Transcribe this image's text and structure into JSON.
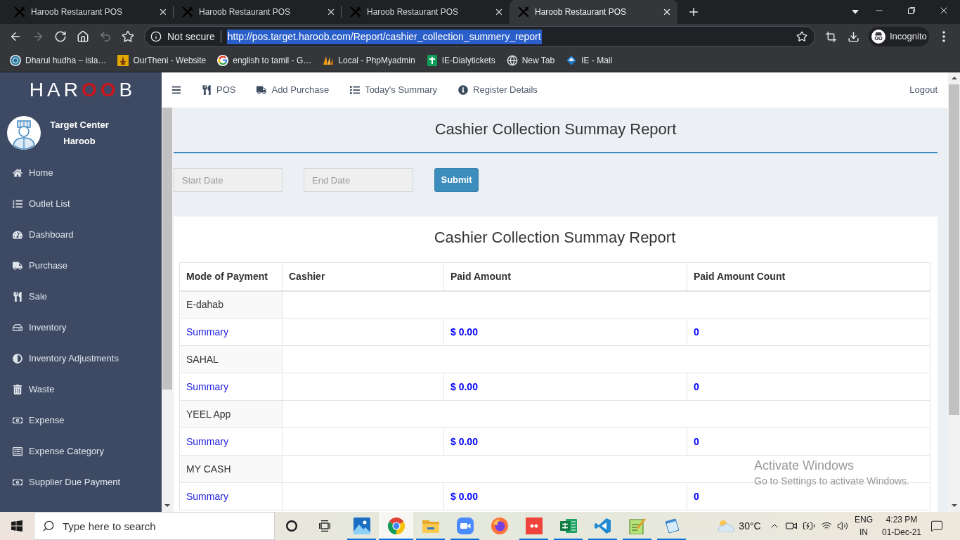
{
  "browser": {
    "tabs": [
      {
        "title": "Haroob Restaurant POS",
        "selected": false
      },
      {
        "title": "Haroob Restaurant POS",
        "selected": false
      },
      {
        "title": "Haroob Restaurant POS",
        "selected": false
      },
      {
        "title": "Haroob Restaurant POS",
        "selected": true
      }
    ],
    "toolbar_buttons": [
      {
        "disabled": false
      },
      {
        "disabled": true
      },
      {
        "disabled": false
      },
      {
        "disabled": false
      },
      {
        "disabled": true
      },
      {
        "disabled": false
      }
    ],
    "address": {
      "security": "Not secure",
      "url": "http://pos.target.haroob.com/Report/cashier_collection_summery_report",
      "selected": true
    },
    "profile": "Incognito",
    "bookmarks": [
      "Dharul hudha – isla…",
      "OurTheni - Website",
      "english to tamil - G…",
      "Local - PhpMyadmin",
      "IE-Dialytickets",
      "New Tab",
      "IE - Mail"
    ]
  },
  "app": {
    "logo": [
      {
        "text": "HAR",
        "accent": false
      },
      {
        "text": "OO",
        "accent": true
      },
      {
        "text": "B",
        "accent": false
      }
    ],
    "user": {
      "name": "Target Center",
      "outlet": "Haroob"
    },
    "sidebar": {
      "items": [
        "Home",
        "Outlet List",
        "Dashboard",
        "Purchase",
        "Sale",
        "Inventory",
        "Inventory Adjustments",
        "Waste",
        "Expense",
        "Expense Category",
        "Supplier Due Payment"
      ]
    },
    "top_nav": {
      "items": [
        "POS",
        "Add Purchase",
        "Today's Summary",
        "Register Details"
      ],
      "logout": "Logout"
    },
    "page_title": "Cashier Collection Summay Report",
    "filters": {
      "start_date": {
        "placeholder": "Start Date"
      },
      "end_date": {
        "placeholder": "End Date"
      },
      "submit": "Submit"
    },
    "report": {
      "title": "Cashier Collection Summay Report",
      "columns": [
        "Mode of Payment",
        "Cashier",
        "Paid Amount",
        "Paid Amount Count"
      ],
      "groups": [
        {
          "mode": "E-dahab",
          "summary": {
            "label": "Summary",
            "paid_amount": "$ 0.00",
            "count": "0"
          }
        },
        {
          "mode": "SAHAL",
          "summary": {
            "label": "Summary",
            "paid_amount": "$ 0.00",
            "count": "0"
          }
        },
        {
          "mode": "YEEL App",
          "summary": {
            "label": "Summary",
            "paid_amount": "$ 0.00",
            "count": "0"
          }
        },
        {
          "mode": "MY CASH",
          "summary": {
            "label": "Summary",
            "paid_amount": "$ 0.00",
            "count": "0"
          }
        }
      ]
    }
  },
  "taskbar": {
    "search": {
      "placeholder": "Type here to search"
    },
    "apps": [
      {
        "running": true,
        "selected": false
      },
      {
        "running": true,
        "selected": true
      },
      {
        "running": true,
        "selected": false
      },
      {
        "running": true,
        "selected": false
      },
      {
        "running": false,
        "selected": false
      },
      {
        "running": true,
        "selected": false
      },
      {
        "running": true,
        "selected": false
      },
      {
        "running": true,
        "selected": false
      },
      {
        "running": true,
        "selected": false
      },
      {
        "running": true,
        "selected": false
      }
    ],
    "weather": "30°C",
    "language": {
      "input": "ENG",
      "region": "IN"
    },
    "clock": {
      "time": "4:23 PM",
      "date": "01-Dec-21"
    }
  },
  "activation_notice": {
    "title": "Activate Windows",
    "subtitle": "Go to Settings to activate Windows."
  }
}
